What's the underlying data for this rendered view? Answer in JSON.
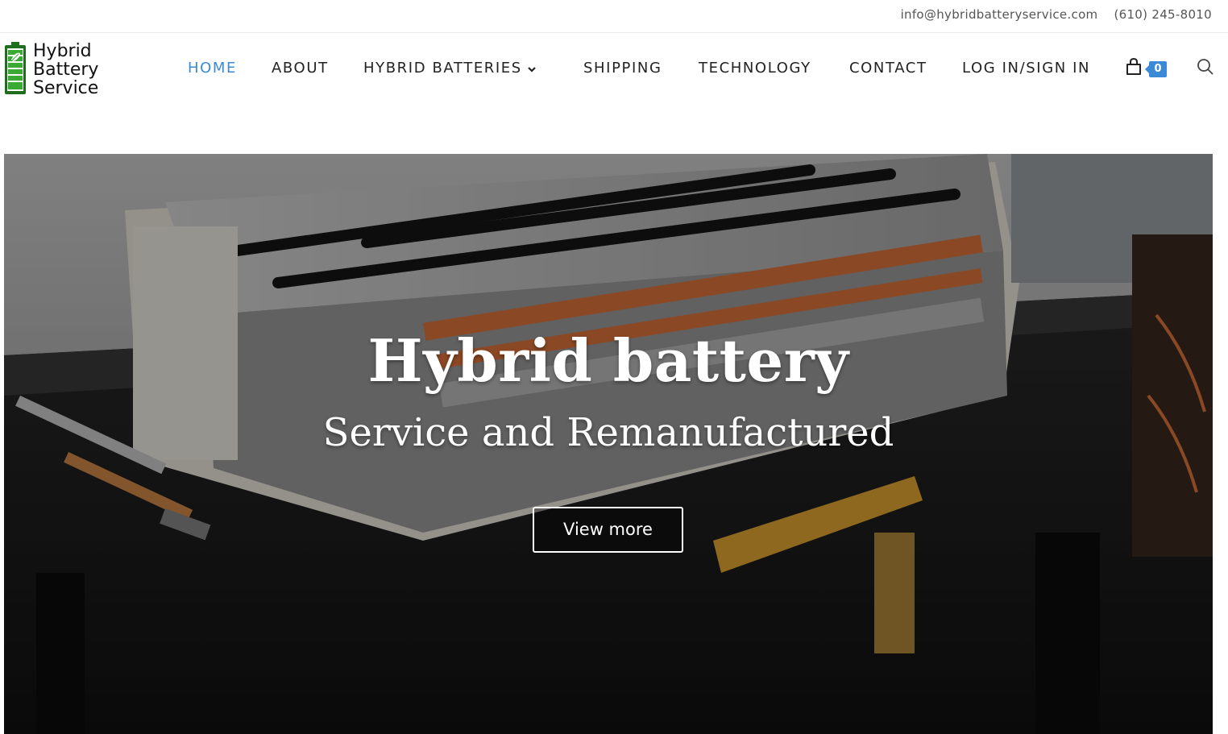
{
  "topbar": {
    "email": "info@hybridbatteryservice.com",
    "phone": "(610) 245-8010"
  },
  "logo": {
    "line1": "Hybrid",
    "line2": "Battery",
    "line3": "Service",
    "icon": "green-battery-leaf-icon"
  },
  "nav": {
    "items": [
      {
        "label": "HOME",
        "active": true
      },
      {
        "label": "ABOUT"
      },
      {
        "label": "HYBRID BATTERIES",
        "has_dropdown": true
      },
      {
        "label": "SHIPPING"
      },
      {
        "label": "TECHNOLOGY"
      },
      {
        "label": "CONTACT"
      },
      {
        "label": "LOG IN/SIGN IN"
      }
    ],
    "cart_count": "0",
    "icons": [
      "cart-icon",
      "search-icon"
    ]
  },
  "hero": {
    "title": "Hybrid battery",
    "subtitle": "Service and Remanufactured",
    "button_label": "View more"
  },
  "colors": {
    "accent": "#3a8ad8",
    "text": "#222222",
    "logo_green": "#2e9e2e",
    "hero_overlay": "rgba(0,0,0,0.38)"
  }
}
